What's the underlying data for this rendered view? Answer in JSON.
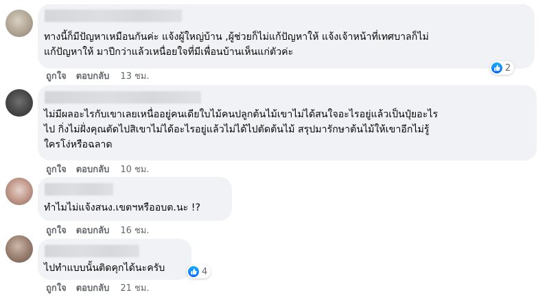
{
  "comments": [
    {
      "text_lines": [
        "ทางนี้ก็มีปัญหาเหมือนกันค่ะ แจ้งผู้ใหญ่บ้าน ,ผู้ช่วยก็ไม่แก้ปัญหาให้ แจ้งเจ้าหน้าที่เทศบาลก็ไม่",
        "แก้ปัญหาให้ มาปีกว่าแล้วเหนื่อยใจที่มีเพื่อนบ้านเห็นแก่ตัวค่ะ"
      ],
      "like_label": "ถูกใจ",
      "reply_label": "ตอบกลับ",
      "time": "13 ชม.",
      "reaction_count": "2"
    },
    {
      "text_lines": [
        "ไม่มีผลอะไรกับเขาเลยเหนื่ออยู่คนเดียใบไม้คนปลูกต้นไม้เขาไม่ได้สนใจอะไรอยู่แล้วเป็นปุ๋ยอะไร",
        "ไป กิ่งไม่ฝั่งคุณตัดไปสิเขาไม่ได้อะไรอยู่แล้วไม่ได้ไปตัดต้นไม้ สรุปมารักษาต้นไม้ให้เขาอีกไม่รู้",
        "ใครโง่หรือฉลาด"
      ],
      "like_label": "ถูกใจ",
      "reply_label": "ตอบกลับ",
      "time": "10 ชม."
    },
    {
      "text_lines": [
        "ทำไมไม่แจ้งสนง.เขตฯหรืออบต.นะ !?"
      ],
      "like_label": "ถูกใจ",
      "reply_label": "ตอบกลับ",
      "time": "16 ชม."
    },
    {
      "text_lines": [
        "ไปทำแบบนั้นติดคุกได้นะครับ"
      ],
      "like_label": "ถูกใจ",
      "reply_label": "ตอบกลับ",
      "time": "21 ชม.",
      "reaction_count": "4"
    }
  ],
  "colors": {
    "bubble": "#f0f2f5",
    "text": "#050505",
    "meta": "#65676b",
    "like_blue": "#0866ff"
  },
  "icons": {
    "reaction": "like-thumb-icon"
  }
}
